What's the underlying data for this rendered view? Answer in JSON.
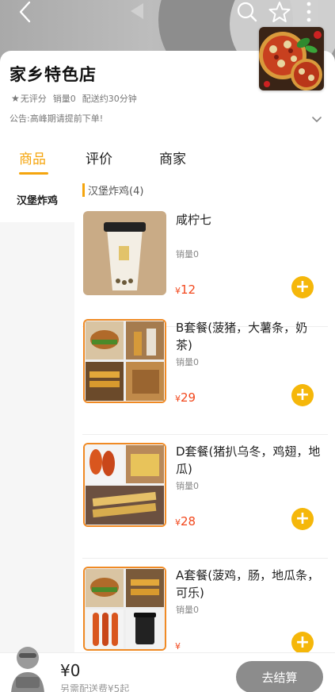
{
  "header": {
    "back_icon": "back-arrow-icon",
    "search_icon": "search-icon",
    "favorite_icon": "star-outline-icon",
    "more_icon": "more-vertical-icon"
  },
  "store": {
    "name": "家乡特色店",
    "rating": "无评分",
    "sales": "销量0",
    "delivery_time": "配送约30分钟",
    "notice": "公告:高峰期请提前下单!"
  },
  "tabs": [
    {
      "label": "商品",
      "active": true
    },
    {
      "label": "评价",
      "active": false
    },
    {
      "label": "商家",
      "active": false
    }
  ],
  "categories": [
    {
      "label": "汉堡炸鸡",
      "active": true
    }
  ],
  "section": {
    "title": "汉堡炸鸡(4)"
  },
  "products": [
    {
      "name": "咸柠七",
      "sales": "销量0",
      "currency": "¥",
      "price": "12"
    },
    {
      "name": "B套餐(菠猪，大薯条，奶茶)",
      "sales": "销量0",
      "currency": "¥",
      "price": "29"
    },
    {
      "name": "D套餐(猪扒乌冬，鸡翅，地瓜)",
      "sales": "销量0",
      "currency": "¥",
      "price": "28"
    },
    {
      "name": "A套餐(菠鸡，肠，地瓜条，可乐)",
      "sales": "销量0",
      "currency": "¥",
      "price": ""
    }
  ],
  "cart": {
    "total": "¥0",
    "note": "另需配送费¥5起",
    "checkout_label": "去结算"
  },
  "colors": {
    "accent": "#f5a50d",
    "price": "#f2471c",
    "add_button": "#f5b70a",
    "checkout_disabled": "#8c8c8c"
  }
}
